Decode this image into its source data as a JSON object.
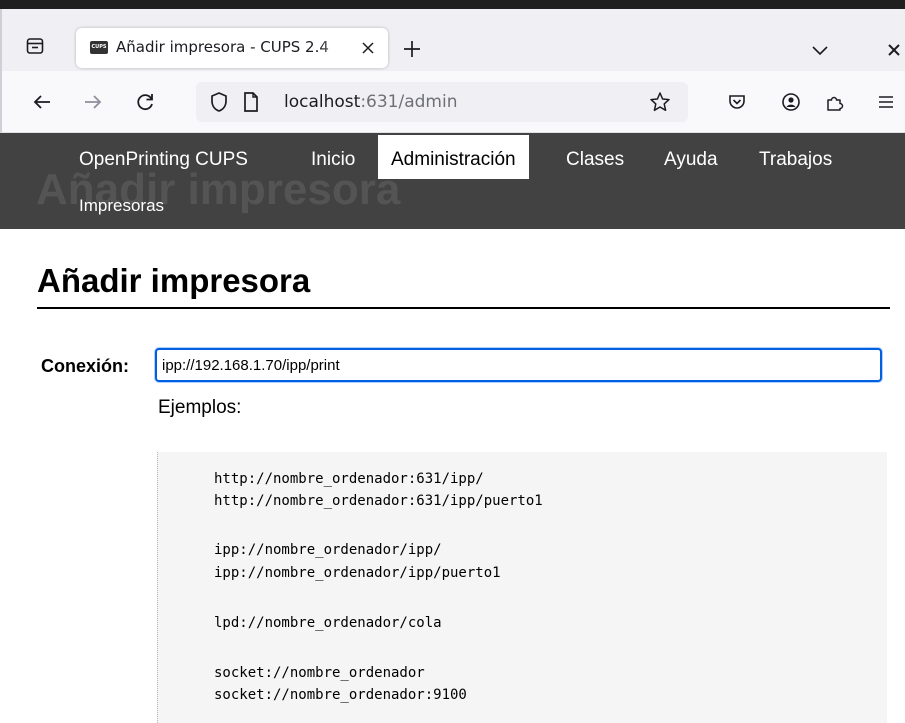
{
  "browser": {
    "tab_title": "Añadir impresora - CUPS 2.4",
    "favicon_text": "CUPS",
    "url_host": "localhost",
    "url_rest": ":631/admin"
  },
  "cups": {
    "header_bg_title": "Añadir impresora",
    "menu": {
      "openprinting": "OpenPrinting CUPS",
      "inicio": "Inicio",
      "administracion": "Administración",
      "clases": "Clases",
      "ayuda": "Ayuda",
      "trabajos": "Trabajos",
      "impresoras": "Impresoras"
    },
    "page_title": "Añadir impresora",
    "connection_label": "Conexión:",
    "connection_value": "ipp://192.168.1.70/ipp/print",
    "examples_label": "Ejemplos:",
    "examples": [
      "http://nombre_ordenador:631/ipp/",
      "http://nombre_ordenador:631/ipp/puerto1",
      "ipp://nombre_ordenador/ipp/",
      "ipp://nombre_ordenador/ipp/puerto1",
      "lpd://nombre_ordenador/cola",
      "socket://nombre_ordenador",
      "socket://nombre_ordenador:9100"
    ]
  },
  "colors": {
    "header_bg": "#424242",
    "focus_ring": "#0060df"
  }
}
